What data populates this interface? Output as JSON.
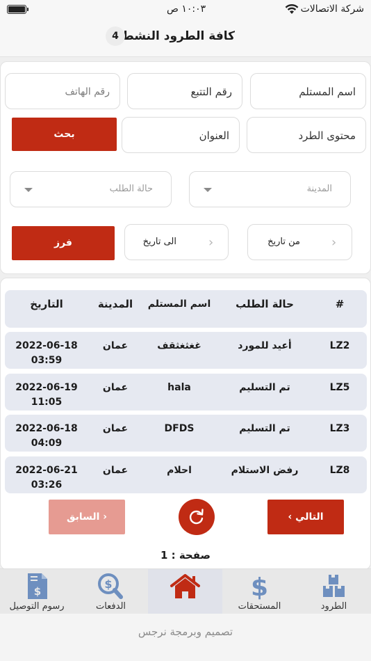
{
  "status": {
    "carrier": "شركة الاتصالات",
    "time": "١٠:٠٣ ص"
  },
  "header": {
    "title": "كافة الطرود النشطة",
    "count": "4"
  },
  "filters": {
    "recipient_name": "اسم المستلم",
    "tracking_number": "رقم التتبع",
    "phone": "رقم الهاتف",
    "parcel_content": "محتوى الطرد",
    "address": "العنوان",
    "search_label": "بحث",
    "city": "المدينة",
    "order_status": "حالة الطلب",
    "from_date": "من تاريخ",
    "to_date": "الى تاريخ",
    "sort_label": "فرز"
  },
  "table": {
    "headers": [
      "#",
      "حالة الطلب",
      "اسم المستلم",
      "المدينة",
      "التاريخ"
    ],
    "rows": [
      {
        "id": "LZ2",
        "status": "أعيد للمورد",
        "name": "غغثغثقف",
        "city": "عمان",
        "date": "2022-06-18",
        "time": "03:59"
      },
      {
        "id": "LZ5",
        "status": "تم التسليم",
        "name": "hala",
        "city": "عمان",
        "date": "2022-06-19",
        "time": "11:05"
      },
      {
        "id": "LZ3",
        "status": "تم التسليم",
        "name": "DFDS",
        "city": "عمان",
        "date": "2022-06-18",
        "time": "04:09"
      },
      {
        "id": "LZ8",
        "status": "رفض الاستلام",
        "name": "احلام",
        "city": "عمان",
        "date": "2022-06-21",
        "time": "03:26"
      }
    ]
  },
  "pager": {
    "prev": "السابق",
    "next": "التالي",
    "page": "صفحة : 1"
  },
  "tabs": [
    {
      "label": "الطرود",
      "icon": "boxes-icon"
    },
    {
      "label": "المستحقات",
      "icon": "dollar-icon"
    },
    {
      "label": "",
      "icon": "home-icon",
      "active": true
    },
    {
      "label": "الدفعات",
      "icon": "search-dollar-icon"
    },
    {
      "label": "رسوم التوصيل",
      "icon": "invoice-icon"
    }
  ],
  "footer": {
    "credit": "تصميم وبرمجة نرجس"
  },
  "colors": {
    "accent": "#c02b14",
    "prev_disabled": "#e69b92",
    "icon_blue": "#6e8fbf",
    "home_red": "#c02b14",
    "row_bg": "#e6e9f1"
  }
}
